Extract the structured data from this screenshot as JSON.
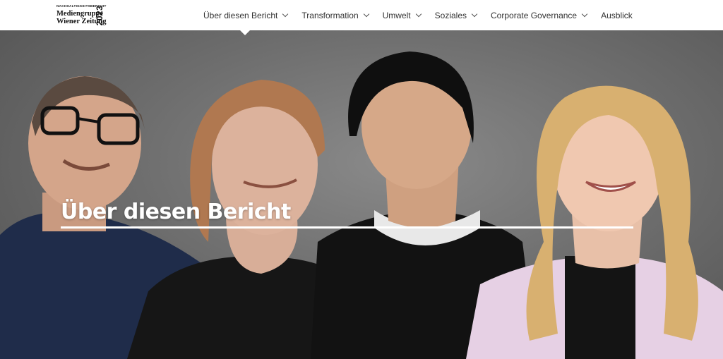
{
  "brand": {
    "kicker": "NACHHALTIGKEITSBERICHT",
    "line1": "Mediengruppe",
    "line2": "Wiener Zeitung",
    "year": "2023"
  },
  "nav": {
    "items": [
      {
        "label": "Über diesen Bericht",
        "has_dropdown": true,
        "active": true
      },
      {
        "label": "Transformation",
        "has_dropdown": true
      },
      {
        "label": "Umwelt",
        "has_dropdown": true
      },
      {
        "label": "Soziales",
        "has_dropdown": true
      },
      {
        "label": "Corporate Governance",
        "has_dropdown": true
      },
      {
        "label": "Ausblick",
        "has_dropdown": false
      }
    ]
  },
  "hero": {
    "title": "Über diesen Bericht",
    "image": "photo of four people looking upward"
  },
  "icons": {
    "dropdown": "chevron-down-icon"
  },
  "colors": {
    "header_bg": "#ffffff",
    "nav_text": "#333333",
    "hero_title": "#ffffff",
    "hero_bg": "#6f6f6f"
  }
}
